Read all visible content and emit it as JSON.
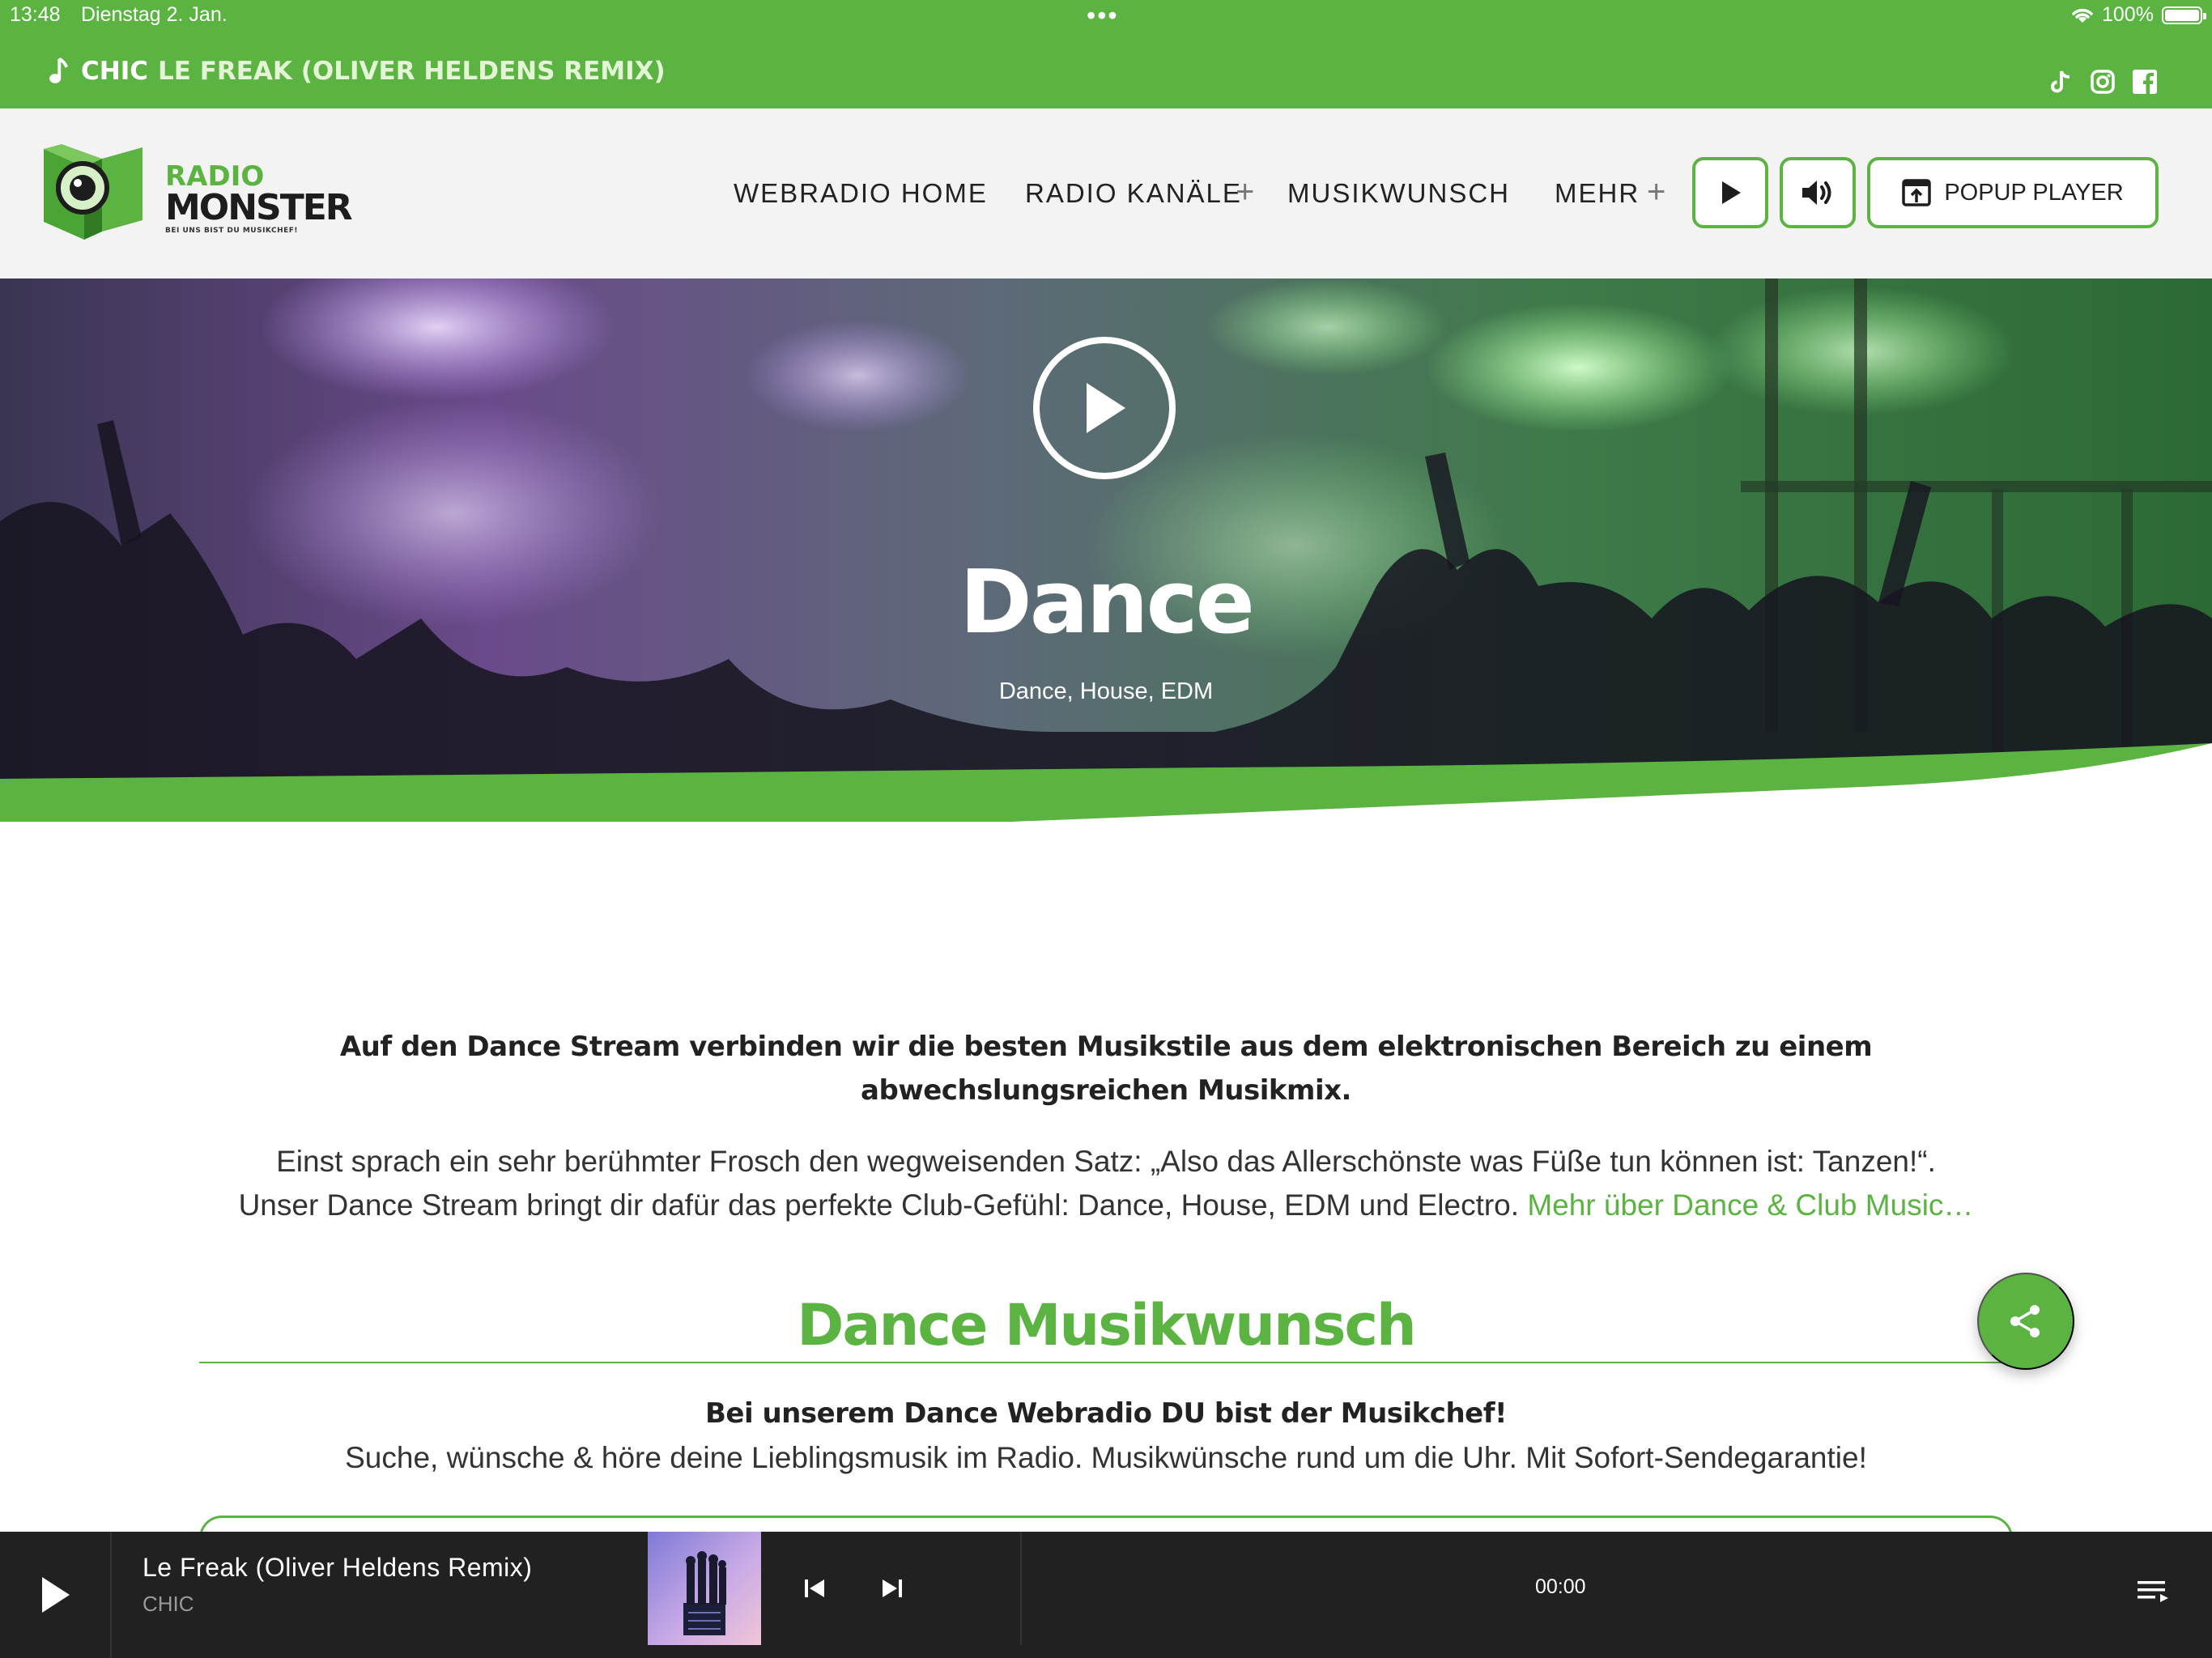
{
  "status_bar": {
    "time": "13:48",
    "date": "Dienstag 2. Jan.",
    "battery": "100%"
  },
  "now_playing": {
    "artist": "CHIC",
    "title": "LE FREAK (OLIVER HELDENS REMIX)"
  },
  "socials": [
    "tiktok-icon",
    "instagram-icon",
    "facebook-icon"
  ],
  "logo": {
    "radio": "RADIO",
    "monster": "MONSTER",
    "slogan": "BEI UNS BIST DU MUSIKCHEF!"
  },
  "nav": {
    "items": [
      {
        "label": "WEBRADIO HOME"
      },
      {
        "label": "RADIO KANÄLE",
        "expand": "+"
      },
      {
        "label": "MUSIKWUNSCH"
      },
      {
        "label": "MEHR",
        "expand": "+"
      }
    ],
    "popup_label": "POPUP PLAYER"
  },
  "hero": {
    "title": "Dance",
    "subtitle": "Dance, House, EDM"
  },
  "content": {
    "intro_bold": "Auf den Dance Stream verbinden wir die besten Musikstile aus dem elektronischen Bereich zu einem abwechslungsreichen Musikmix.",
    "intro_line1": "Einst sprach ein sehr berühmter Frosch den wegweisenden Satz: „Also das Allerschönste was Füße tun können ist: Tanzen!“.",
    "intro_line2": "Unser Dance Stream bringt dir dafür das perfekte Club-Gefühl: Dance, House, EDM und Electro.",
    "intro_link": "Mehr über Dance & Club Music…",
    "section_title": "Dance Musikwunsch",
    "request_bold": "Bei unserem Dance Webradio DU bist der Musikchef!",
    "request_text": "Suche, wünsche & höre deine Lieblingsmusik im Radio. Musikwünsche rund um die Uhr. Mit Sofort-Sendegarantie!"
  },
  "player": {
    "track": "Le Freak (Oliver Heldens Remix)",
    "artist": "CHIC",
    "time": "00:00"
  },
  "colors": {
    "brand_green": "#5bb341",
    "player_bg": "#212121",
    "header_bg": "#f4f3f4"
  }
}
